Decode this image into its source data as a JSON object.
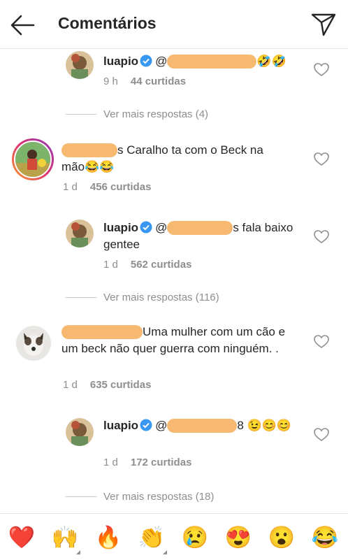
{
  "header": {
    "title": "Comentários"
  },
  "comments": [
    {
      "username": "luapio",
      "text": "",
      "trail": "🤣🤣",
      "time": "9 h",
      "likes": "44 curtidas"
    },
    {
      "text": "s Caralho ta com o Beck na mão😂😂",
      "time": "1 d",
      "likes": "456 curtidas"
    },
    {
      "username": "luapio",
      "text": "s fala baixo gentee",
      "time": "1 d",
      "likes": "562 curtidas"
    },
    {
      "text": "Uma mulher com um cão e um beck não quer guerra com ninguém. .",
      "time": "1 d",
      "likes": "635 curtidas"
    },
    {
      "username": "luapio",
      "text": "8 😉😊😊",
      "time": "1 d",
      "likes": "172 curtidas"
    }
  ],
  "more_replies": [
    "Ver mais respostas (4)",
    "Ver mais respostas (116)",
    "Ver mais respostas (18)"
  ],
  "reply_prefix": "@",
  "emoji_bar": [
    "❤️",
    "🙌",
    "🔥",
    "👏",
    "😢",
    "😍",
    "😮",
    "😂"
  ],
  "colors": {
    "verified": "#3897f0",
    "redaction": "#f7b56a",
    "muted": "#8e8e8e",
    "heart": "#ed4956"
  }
}
